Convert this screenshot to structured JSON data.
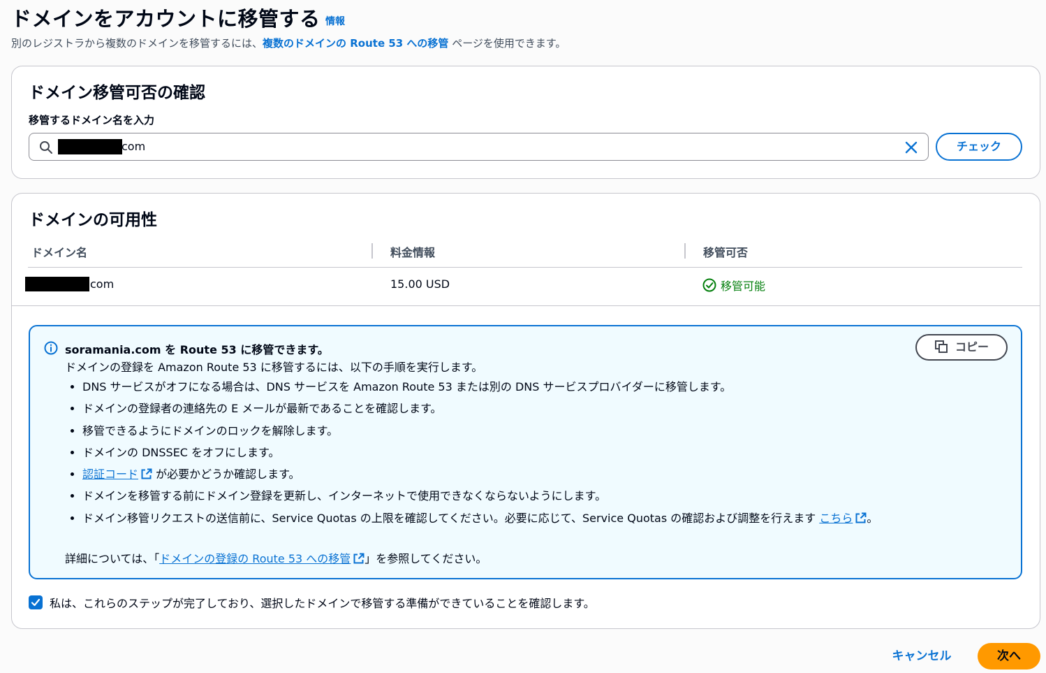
{
  "header": {
    "title": "ドメインをアカウントに移管する",
    "info_label": "情報",
    "subtitle_before": "別のレジストラから複数のドメインを移管するには、",
    "subtitle_link": "複数のドメインの Route 53 への移管",
    "subtitle_after": " ページを使用できます。"
  },
  "check_card": {
    "heading": "ドメイン移管可否の確認",
    "field_label": "移管するドメイン名を入力",
    "input_value_suffix": "com",
    "check_button": "チェック"
  },
  "availability_card": {
    "heading": "ドメインの可用性",
    "columns": [
      "ドメイン名",
      "料金情報",
      "移管可否"
    ],
    "row": {
      "domain_suffix": "com",
      "price": "15.00 USD",
      "status": "移管可能"
    }
  },
  "alert": {
    "title": "soramania.com を Route 53 に移管できます。",
    "intro": "ドメインの登録を Amazon Route 53 に移管するには、以下の手順を実行します。",
    "copy_button": "コピー",
    "steps": [
      "DNS サービスがオフになる場合は、DNS サービスを Amazon Route 53 または別の DNS サービスプロバイダーに移管します。",
      "ドメインの登録者の連絡先の E メールが最新であることを確認します。",
      "移管できるようにドメインのロックを解除します。",
      "ドメインの DNSSEC をオフにします。"
    ],
    "auth_code_link": "認証コード",
    "auth_code_after": " が必要かどうか確認します。",
    "renew_step": "ドメインを移管する前にドメイン登録を更新し、インターネットで使用できなくならないようにします。",
    "quota_step": "ドメイン移管リクエストの送信前に、Service Quotas の上限を確認してください。必要に応じて、Service Quotas の確認および調整を行えます ",
    "quota_link": "こちら",
    "quota_after": "。",
    "footer_before": "詳細については、「",
    "footer_link": "ドメインの登録の Route 53 への移管",
    "footer_after": "」を参照してください。"
  },
  "confirm": {
    "label": "私は、これらのステップが完了しており、選択したドメインで移管する準備ができていることを確認します。"
  },
  "actions": {
    "cancel": "キャンセル",
    "next": "次へ"
  },
  "colors": {
    "link": "#0972d3",
    "success": "#037f0c",
    "primary_button": "#ff9900",
    "alert_background": "#f0fbff"
  }
}
